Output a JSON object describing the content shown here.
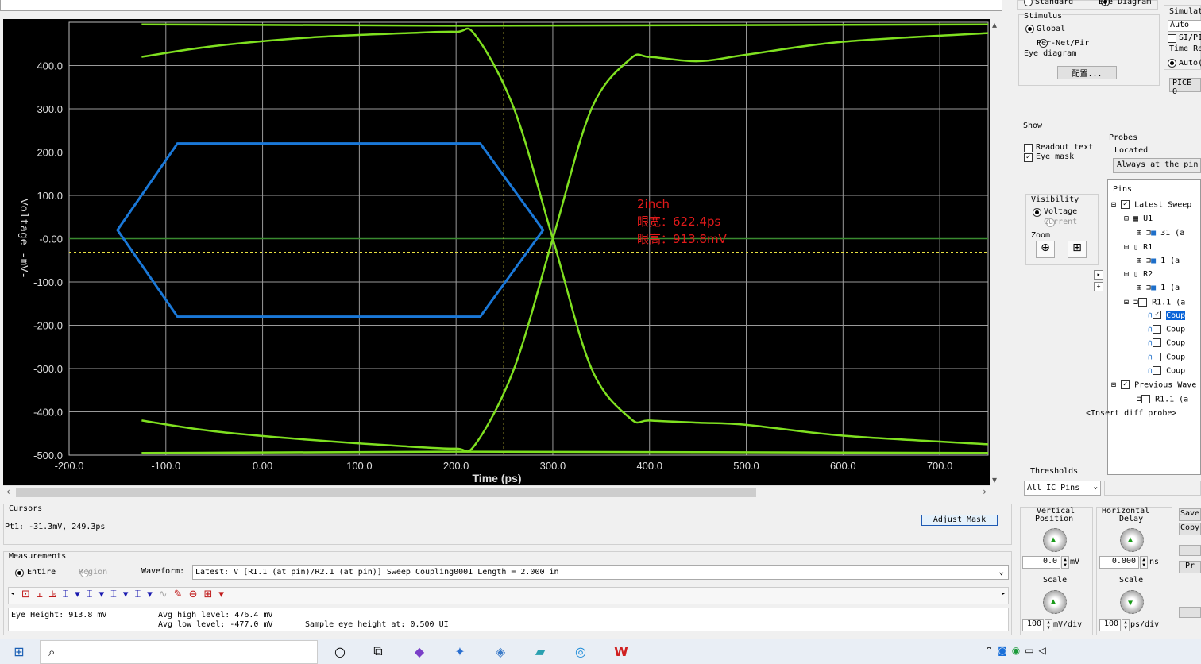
{
  "top_options": {
    "standard": "Standard",
    "eye_diagram": "Eye Diagram",
    "simulat": "Simulat"
  },
  "stimulus": {
    "title": "Stimulus",
    "global": "Global",
    "per_net": "Per-Net/Pir",
    "eye_diagram": "Eye diagram",
    "config_button": "配置..."
  },
  "sim_panel": {
    "auto": "Auto",
    "si_pi": "SI/PI",
    "time_re": "Time Re",
    "auto_opt": "Auto(",
    "pice": "PICE O"
  },
  "show": {
    "title": "Show",
    "readout_text": "Readout text",
    "eye_mask": "Eye mask"
  },
  "probes": {
    "title": "Probes",
    "located": "Located",
    "located_value": "Always at the pin"
  },
  "visibility": {
    "title": "Visibility",
    "voltage": "Voltage",
    "current": "Current"
  },
  "zoom": {
    "title": "Zoom"
  },
  "pins": {
    "title": "Pins",
    "items": [
      {
        "label": "Latest Sweep"
      },
      {
        "label": "U1"
      },
      {
        "label": "31 (a"
      },
      {
        "label": "R1"
      },
      {
        "label": "1 (a"
      },
      {
        "label": "R2"
      },
      {
        "label": "1 (a"
      },
      {
        "label": "R1.1 (a"
      },
      {
        "label": "Coup"
      },
      {
        "label": "Coup"
      },
      {
        "label": "Coup"
      },
      {
        "label": "Coup"
      },
      {
        "label": "Coup"
      },
      {
        "label": "Previous Wave"
      },
      {
        "label": "R1.1 (a"
      },
      {
        "label": "<Insert diff probe>"
      }
    ]
  },
  "thresholds": {
    "title": "Thresholds",
    "value": "All IC Pins"
  },
  "cursors": {
    "title": "Cursors",
    "pt1": "Pt1: -31.3mV, 249.3ps",
    "adjust_mask": "Adjust Mask"
  },
  "measurements": {
    "title": "Measurements",
    "entire": "Entire",
    "region": "Region",
    "waveform_label": "Waveform:",
    "waveform_value": "Latest: V [R1.1 (at pin)/R2.1 (at pin)] Sweep Coupling0001 Length = 2.000 in",
    "eye_height": "Eye Height: 913.8 mV",
    "avg_high": "Avg high level: 476.4 mV",
    "avg_low": "Avg low level: -477.0 mV",
    "sample_eye": "Sample eye height at: 0.500 UI"
  },
  "vertical": {
    "title1": "Vertical",
    "title2": "Position",
    "value": "0.0",
    "unit": "mV",
    "scale_title": "Scale",
    "scale_value": "100",
    "scale_unit": "mV/div"
  },
  "horizontal": {
    "title1": "Horizontal",
    "title2": "Delay",
    "value": "0.000",
    "unit": "ns",
    "scale_title": "Scale",
    "scale_value": "100",
    "scale_unit": "ps/div"
  },
  "side_buttons": {
    "save": "Save",
    "copy": "Copy",
    "pr": "Pr"
  },
  "annotation": {
    "line1": "2inch",
    "line2": "眼宽：622.4ps",
    "line3": "眼高：913.8mV"
  },
  "chart_data": {
    "type": "line",
    "xlabel": "Time (ps)",
    "ylabel": "Voltage -mV-",
    "xlim": [
      -200,
      750
    ],
    "ylim": [
      -500,
      500
    ],
    "x_ticks": [
      "-200.0",
      "-100.0",
      "0.00",
      "100.0",
      "200.0",
      "300.0",
      "400.0",
      "500.0",
      "600.0",
      "700.0"
    ],
    "y_ticks": [
      "400.0",
      "300.0",
      "200.0",
      "100.0",
      "-0.00",
      "-100.0",
      "-200.0",
      "-300.0",
      "-400.0",
      "-500.0"
    ],
    "grid": true,
    "colors": {
      "trace": "#7fe020",
      "mask": "#1a78d8",
      "cursor": "#e8e040",
      "zero": "#3a8a30"
    },
    "mask_polygon": [
      [
        -150,
        20
      ],
      [
        -88,
        220
      ],
      [
        225,
        220
      ],
      [
        290,
        20
      ],
      [
        225,
        -180
      ],
      [
        -88,
        -180
      ]
    ],
    "cursor_x": 249.3,
    "cursor_y": -31.3,
    "series": [
      {
        "x": [
          -125,
          -50,
          50,
          150,
          200,
          220,
          260,
          300,
          340,
          380,
          400,
          450,
          500,
          600,
          750
        ],
        "values": [
          420,
          445,
          465,
          475,
          478,
          470,
          300,
          0,
          -300,
          -415,
          -420,
          -425,
          -430,
          -455,
          -475
        ]
      },
      {
        "x": [
          -125,
          -50,
          50,
          150,
          200,
          220,
          260,
          300,
          340,
          380,
          400,
          450,
          500,
          600,
          750
        ],
        "values": [
          -420,
          -445,
          -465,
          -480,
          -485,
          -475,
          -300,
          0,
          300,
          415,
          420,
          410,
          425,
          455,
          475
        ]
      },
      {
        "x": [
          -125,
          200,
          750
        ],
        "values": [
          495,
          492,
          495
        ]
      },
      {
        "x": [
          -125,
          200,
          750
        ],
        "values": [
          -495,
          -492,
          -495
        ]
      }
    ]
  }
}
